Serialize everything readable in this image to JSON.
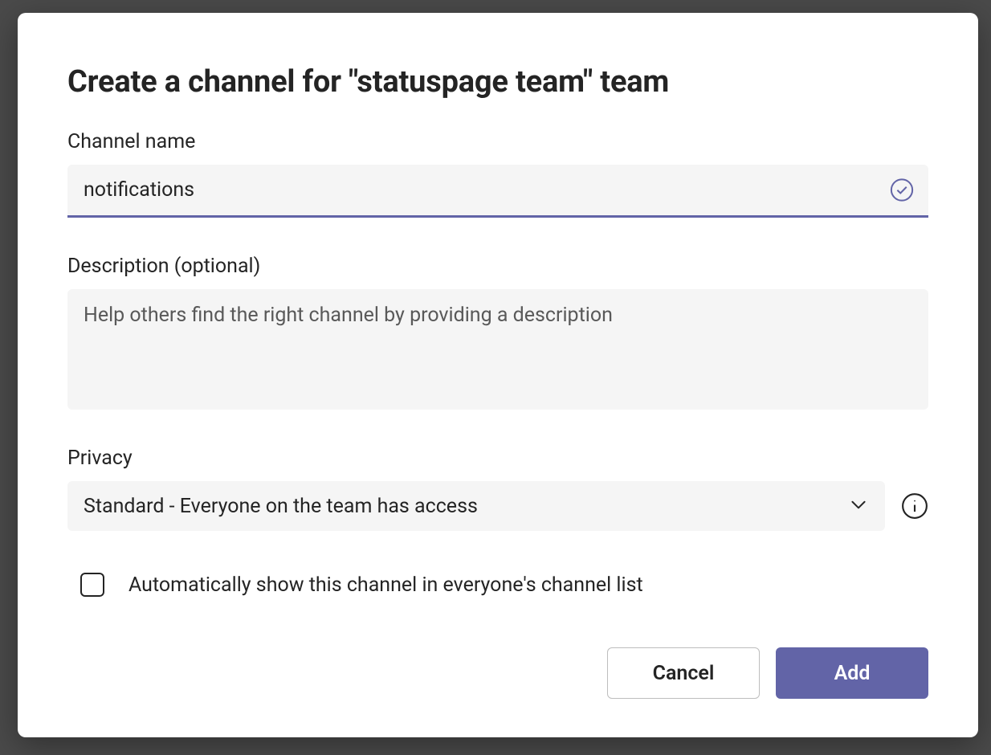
{
  "dialog": {
    "title": "Create a channel for \"statuspage team\" team",
    "channel_name": {
      "label": "Channel name",
      "value": "notifications"
    },
    "description": {
      "label": "Description (optional)",
      "placeholder": "Help others find the right channel by providing a description",
      "value": ""
    },
    "privacy": {
      "label": "Privacy",
      "selected": "Standard - Everyone on the team has access"
    },
    "auto_show": {
      "label": "Automatically show this channel in everyone's channel list",
      "checked": false
    },
    "buttons": {
      "cancel": "Cancel",
      "add": "Add"
    }
  },
  "colors": {
    "accent": "#6264a7"
  }
}
